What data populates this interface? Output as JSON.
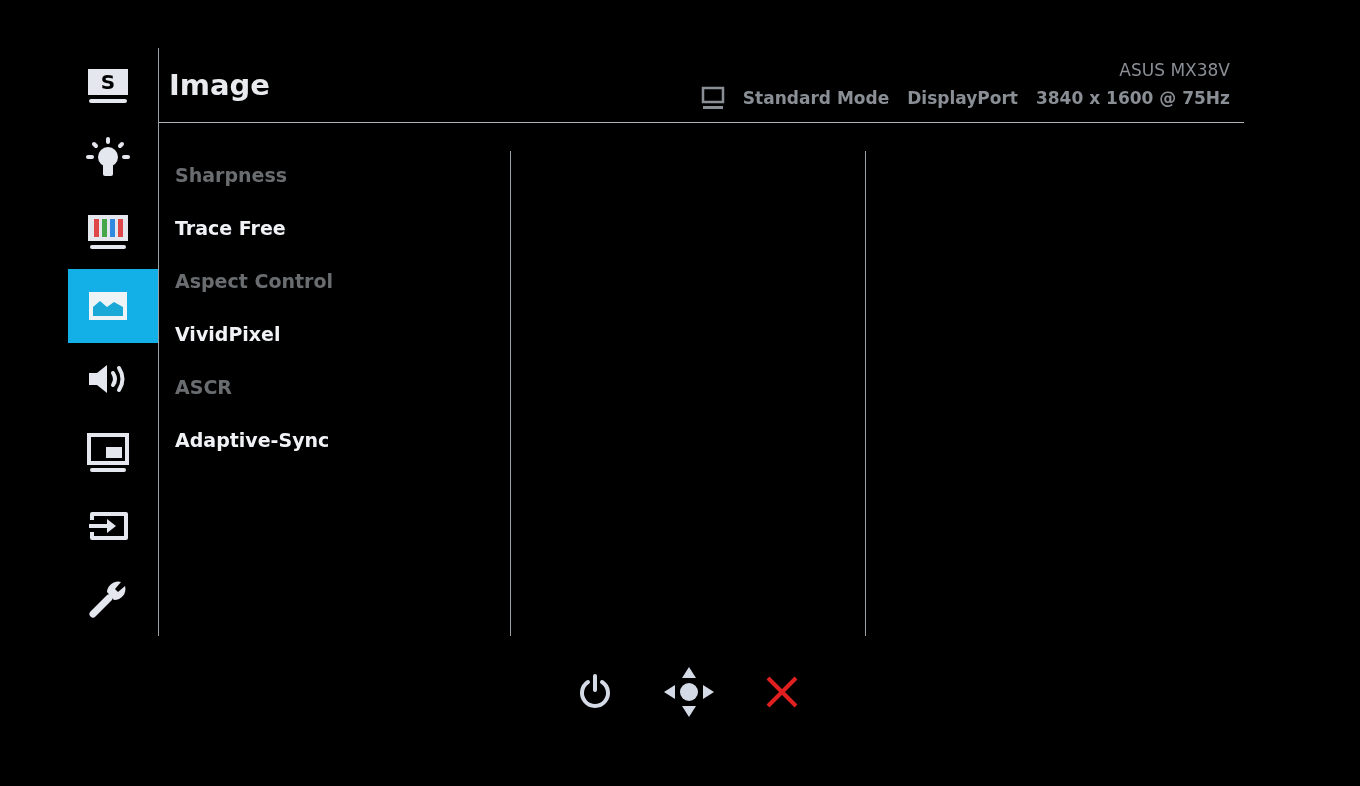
{
  "sidebar": {
    "items": [
      {
        "kind": "splendid",
        "label": "S",
        "selected": false
      },
      {
        "kind": "brightness",
        "selected": false
      },
      {
        "kind": "color",
        "selected": false
      },
      {
        "kind": "image",
        "selected": true
      },
      {
        "kind": "sound",
        "selected": false
      },
      {
        "kind": "pip",
        "selected": false
      },
      {
        "kind": "input",
        "selected": false
      },
      {
        "kind": "system",
        "selected": false
      }
    ]
  },
  "header": {
    "title": "Image",
    "model": "ASUS MX38V",
    "mode": "Standard Mode",
    "input": "DisplayPort",
    "resolution": "3840 x 1600 @ 75Hz"
  },
  "menu": {
    "items": [
      {
        "label": "Sharpness",
        "disabled": true
      },
      {
        "label": "Trace Free",
        "disabled": false
      },
      {
        "label": "Aspect Control",
        "disabled": true
      },
      {
        "label": "VividPixel",
        "disabled": false
      },
      {
        "label": "ASCR",
        "disabled": true
      },
      {
        "label": "Adaptive-Sync",
        "disabled": false
      }
    ]
  },
  "buttons": [
    {
      "kind": "power"
    },
    {
      "kind": "navigate"
    },
    {
      "kind": "close"
    }
  ]
}
